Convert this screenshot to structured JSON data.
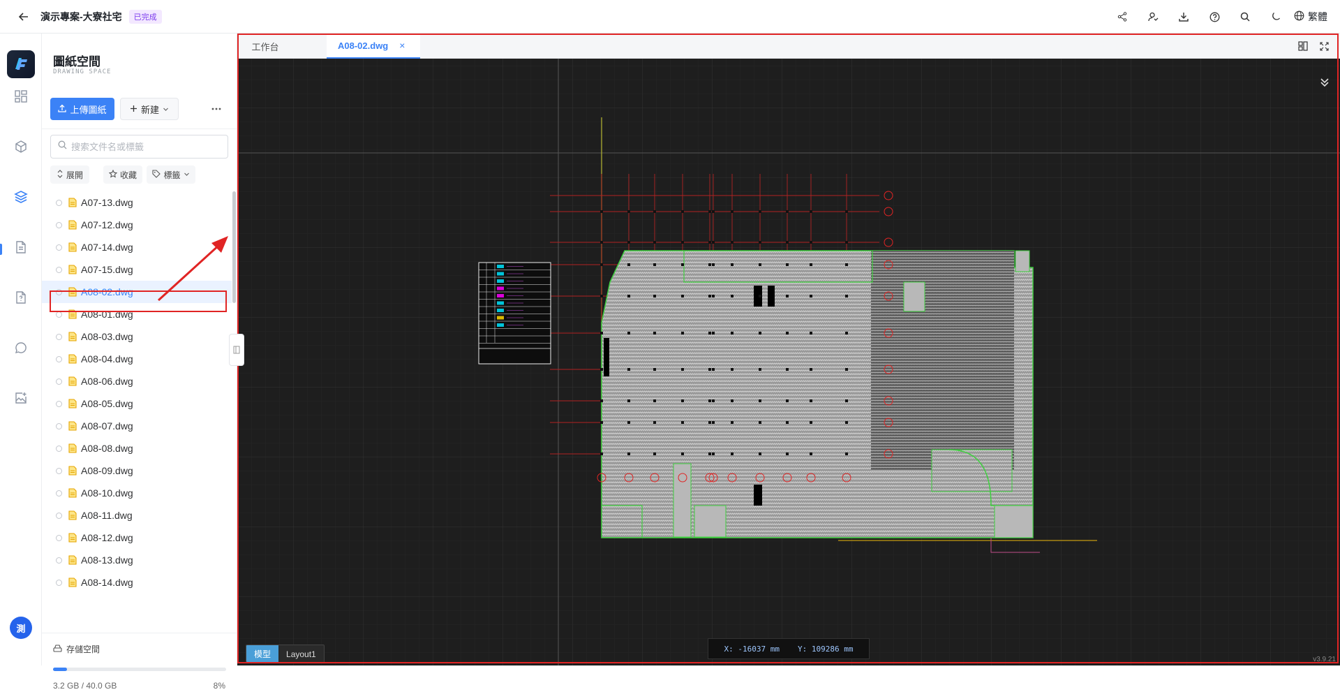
{
  "header": {
    "project_title": "演示專案-大寮社宅",
    "status": "已完成",
    "language": "繁體",
    "icons": [
      "share-icon",
      "user-share-icon",
      "download-icon",
      "help-icon",
      "search-icon",
      "moon-icon",
      "globe-icon"
    ]
  },
  "rail": {
    "items": [
      "dashboard-icon",
      "model-icon",
      "layers-icon",
      "document-icon",
      "file-question-icon",
      "chat-icon",
      "image-add-icon"
    ],
    "active": "layers-icon",
    "avatar_text": "測"
  },
  "sidebar": {
    "title": "圖紙空間",
    "subtitle": "DRAWING SPACE",
    "upload_label": "上傳圖紙",
    "new_label": "新建",
    "search_placeholder": "搜索文件名或標籤",
    "filters": {
      "expand": "展開",
      "favorites": "收藏",
      "tags": "標籤"
    },
    "files": [
      "A07-13.dwg",
      "A07-12.dwg",
      "A07-14.dwg",
      "A07-15.dwg",
      "A08-02.dwg",
      "A08-01.dwg",
      "A08-03.dwg",
      "A08-04.dwg",
      "A08-06.dwg",
      "A08-05.dwg",
      "A08-07.dwg",
      "A08-08.dwg",
      "A08-09.dwg",
      "A08-10.dwg",
      "A08-11.dwg",
      "A08-12.dwg",
      "A08-13.dwg",
      "A08-14.dwg"
    ],
    "selected_file": "A08-02.dwg",
    "storage": {
      "label": "存儲空間",
      "used_text": "3.2 GB / 40.0 GB",
      "percent_text": "8%",
      "fraction": 0.08
    }
  },
  "viewer": {
    "tabs": [
      {
        "label": "工作台",
        "active": false
      },
      {
        "label": "A08-02.dwg",
        "active": true
      }
    ],
    "layout_tabs": [
      "模型",
      "Layout1"
    ],
    "active_layout": "模型",
    "coords": {
      "x": "X: -16037 mm",
      "y": "Y: 109286 mm"
    },
    "version": "v3.9.21"
  },
  "colors": {
    "accent": "#3b82f6",
    "highlight": "#e02424",
    "canvas_bg": "#1e1e1e",
    "status_badge": "#7c3aed"
  }
}
